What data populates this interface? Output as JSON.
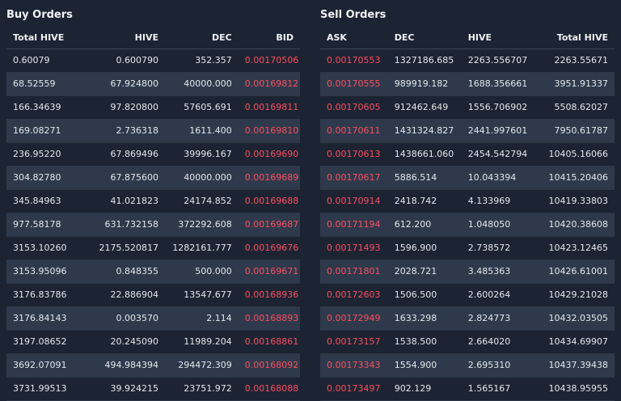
{
  "buy": {
    "title": "Buy Orders",
    "columns": [
      "Total HIVE",
      "HIVE",
      "DEC",
      "BID"
    ],
    "rows": [
      [
        "0.60079",
        "0.600790",
        "352.357",
        "0.00170506"
      ],
      [
        "68.52559",
        "67.924800",
        "40000.000",
        "0.00169812"
      ],
      [
        "166.34639",
        "97.820800",
        "57605.691",
        "0.00169811"
      ],
      [
        "169.08271",
        "2.736318",
        "1611.400",
        "0.00169810"
      ],
      [
        "236.95220",
        "67.869496",
        "39996.167",
        "0.00169690"
      ],
      [
        "304.82780",
        "67.875600",
        "40000.000",
        "0.00169689"
      ],
      [
        "345.84963",
        "41.021823",
        "24174.852",
        "0.00169688"
      ],
      [
        "977.58178",
        "631.732158",
        "372292.608",
        "0.00169687"
      ],
      [
        "3153.10260",
        "2175.520817",
        "1282161.777",
        "0.00169676"
      ],
      [
        "3153.95096",
        "0.848355",
        "500.000",
        "0.00169671"
      ],
      [
        "3176.83786",
        "22.886904",
        "13547.677",
        "0.00168936"
      ],
      [
        "3176.84143",
        "0.003570",
        "2.114",
        "0.00168893"
      ],
      [
        "3197.08652",
        "20.245090",
        "11989.204",
        "0.00168861"
      ],
      [
        "3692.07091",
        "494.984394",
        "294472.309",
        "0.00168092"
      ],
      [
        "3731.99513",
        "39.924215",
        "23751.972",
        "0.00168088"
      ]
    ]
  },
  "sell": {
    "title": "Sell Orders",
    "columns": [
      "ASK",
      "DEC",
      "HIVE",
      "Total HIVE"
    ],
    "rows": [
      [
        "0.00170553",
        "1327186.685",
        "2263.556707",
        "2263.55671"
      ],
      [
        "0.00170555",
        "989919.182",
        "1688.356661",
        "3951.91337"
      ],
      [
        "0.00170605",
        "912462.649",
        "1556.706902",
        "5508.62027"
      ],
      [
        "0.00170611",
        "1431324.827",
        "2441.997601",
        "7950.61787"
      ],
      [
        "0.00170613",
        "1438661.060",
        "2454.542794",
        "10405.16066"
      ],
      [
        "0.00170617",
        "5886.514",
        "10.043394",
        "10415.20406"
      ],
      [
        "0.00170914",
        "2418.742",
        "4.133969",
        "10419.33803"
      ],
      [
        "0.00171194",
        "612.200",
        "1.048050",
        "10420.38608"
      ],
      [
        "0.00171493",
        "1596.900",
        "2.738572",
        "10423.12465"
      ],
      [
        "0.00171801",
        "2028.721",
        "3.485363",
        "10426.61001"
      ],
      [
        "0.00172603",
        "1506.500",
        "2.600264",
        "10429.21028"
      ],
      [
        "0.00172949",
        "1633.298",
        "2.824773",
        "10432.03505"
      ],
      [
        "0.00173157",
        "1538.500",
        "2.664020",
        "10434.69907"
      ],
      [
        "0.00173343",
        "1554.900",
        "2.695310",
        "10437.39438"
      ],
      [
        "0.00173497",
        "902.129",
        "1.565167",
        "10438.95955"
      ]
    ]
  },
  "colors": {
    "background": "#1c2433",
    "row_alt": "#2e3a4c",
    "price_red": "#ff4d5e"
  }
}
